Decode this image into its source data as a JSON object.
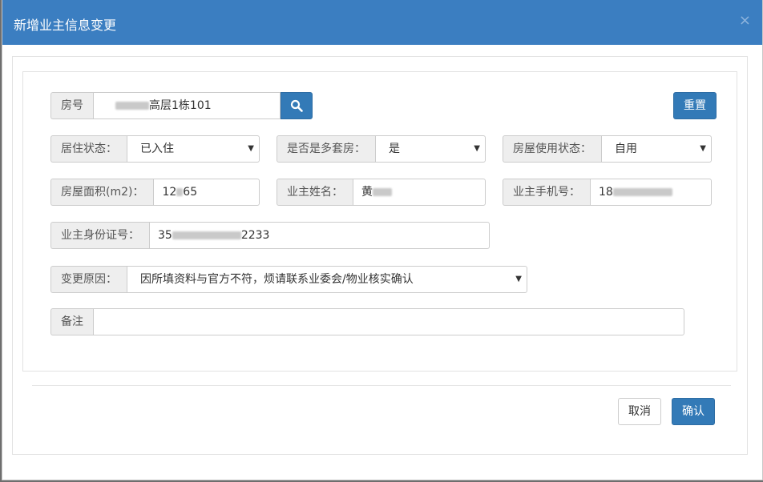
{
  "modal": {
    "title": "新增业主信息变更",
    "close": "×"
  },
  "form": {
    "room": {
      "label": "房号",
      "value_suffix": "高层1栋101"
    },
    "reset_label": "重置",
    "residence_status": {
      "label": "居住状态：",
      "value": "已入住"
    },
    "multi_house": {
      "label": "是否是多套房：",
      "value": "是"
    },
    "usage_status": {
      "label": "房屋使用状态：",
      "value": "自用"
    },
    "area": {
      "label": "房屋面积(m2)：",
      "value_prefix": "12",
      "value_suffix": "65"
    },
    "owner_name": {
      "label": "业主姓名：",
      "value_prefix": "黄"
    },
    "owner_phone": {
      "label": "业主手机号：",
      "value_prefix": "18"
    },
    "owner_id": {
      "label": "业主身份证号：",
      "value_prefix": "35",
      "value_suffix": "2233"
    },
    "reason": {
      "label": "变更原因：",
      "value": "因所填资料与官方不符，烦请联系业委会/物业核实确认"
    },
    "remark": {
      "label": "备注",
      "value": ""
    }
  },
  "footer": {
    "cancel_label": "取消",
    "confirm_label": "确认"
  },
  "icons": {
    "search": "search-icon",
    "caret": "▼"
  },
  "colors": {
    "header": "#3b7ec1",
    "primary": "#337ab7",
    "addon_bg": "#eeeeee"
  }
}
